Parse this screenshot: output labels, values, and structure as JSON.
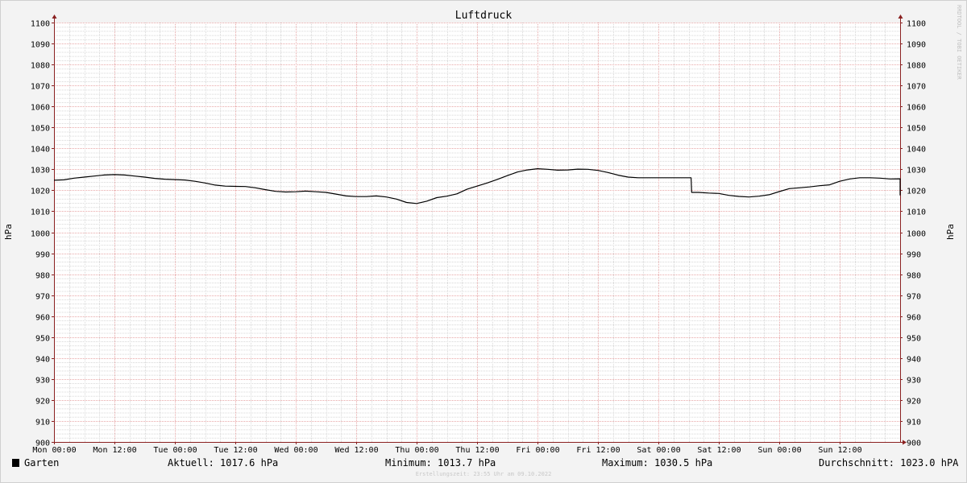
{
  "chart_data": {
    "type": "line",
    "title": "Luftdruck",
    "ylabel": "hPa",
    "ylabel_right": "hPa",
    "ylim": [
      900,
      1100
    ],
    "y_ticks": [
      900,
      910,
      920,
      930,
      940,
      950,
      960,
      970,
      980,
      990,
      1000,
      1010,
      1020,
      1030,
      1040,
      1050,
      1060,
      1070,
      1080,
      1090,
      1100
    ],
    "x_ticks": [
      "Mon 00:00",
      "Mon 12:00",
      "Tue 00:00",
      "Tue 12:00",
      "Wed 00:00",
      "Wed 12:00",
      "Thu 00:00",
      "Thu 12:00",
      "Fri 00:00",
      "Fri 12:00",
      "Sat 00:00",
      "Sat 12:00",
      "Sun 00:00",
      "Sun 12:00"
    ],
    "xlim_hours": [
      0,
      168
    ],
    "grid": true,
    "side_text": "RRDTOOL / TOBI OETIKER",
    "series": [
      {
        "name": "Garten",
        "color": "#000000",
        "points": [
          [
            0,
            1024.8
          ],
          [
            2,
            1025.0
          ],
          [
            4,
            1025.8
          ],
          [
            6,
            1026.3
          ],
          [
            8,
            1026.8
          ],
          [
            10,
            1027.3
          ],
          [
            12,
            1027.5
          ],
          [
            14,
            1027.3
          ],
          [
            16,
            1026.8
          ],
          [
            18,
            1026.3
          ],
          [
            20,
            1025.7
          ],
          [
            22,
            1025.3
          ],
          [
            24,
            1025.1
          ],
          [
            26,
            1024.9
          ],
          [
            28,
            1024.3
          ],
          [
            30,
            1023.5
          ],
          [
            32,
            1022.5
          ],
          [
            34,
            1022.0
          ],
          [
            36,
            1021.9
          ],
          [
            38,
            1021.8
          ],
          [
            40,
            1021.2
          ],
          [
            42,
            1020.3
          ],
          [
            44,
            1019.5
          ],
          [
            46,
            1019.2
          ],
          [
            48,
            1019.3
          ],
          [
            50,
            1019.6
          ],
          [
            52,
            1019.3
          ],
          [
            54,
            1019.0
          ],
          [
            56,
            1018.2
          ],
          [
            58,
            1017.3
          ],
          [
            60,
            1017.0
          ],
          [
            62,
            1017.0
          ],
          [
            64,
            1017.3
          ],
          [
            66,
            1016.8
          ],
          [
            68,
            1015.8
          ],
          [
            70,
            1014.2
          ],
          [
            72,
            1013.7
          ],
          [
            74,
            1014.8
          ],
          [
            76,
            1016.5
          ],
          [
            78,
            1017.2
          ],
          [
            80,
            1018.3
          ],
          [
            82,
            1020.5
          ],
          [
            84,
            1022.0
          ],
          [
            86,
            1023.5
          ],
          [
            88,
            1025.2
          ],
          [
            90,
            1027.0
          ],
          [
            92,
            1028.7
          ],
          [
            94,
            1029.7
          ],
          [
            96,
            1030.3
          ],
          [
            98,
            1030.0
          ],
          [
            100,
            1029.6
          ],
          [
            102,
            1029.7
          ],
          [
            104,
            1030.1
          ],
          [
            106,
            1030.0
          ],
          [
            108,
            1029.5
          ],
          [
            110,
            1028.5
          ],
          [
            112,
            1027.2
          ],
          [
            114,
            1026.3
          ],
          [
            116,
            1026.0
          ],
          [
            118,
            1026.0
          ],
          [
            120,
            1026.0
          ],
          [
            124,
            1026.0
          ],
          [
            126.5,
            1026.0
          ],
          [
            126.6,
            1019.0
          ],
          [
            128,
            1019.0
          ],
          [
            130,
            1018.7
          ],
          [
            132,
            1018.5
          ],
          [
            134,
            1017.6
          ],
          [
            136,
            1017.1
          ],
          [
            138,
            1016.8
          ],
          [
            140,
            1017.2
          ],
          [
            142,
            1017.9
          ],
          [
            144,
            1019.4
          ],
          [
            146,
            1020.8
          ],
          [
            148,
            1021.2
          ],
          [
            150,
            1021.6
          ],
          [
            152,
            1022.2
          ],
          [
            154,
            1022.6
          ],
          [
            156,
            1024.3
          ],
          [
            158,
            1025.4
          ],
          [
            160,
            1026.0
          ],
          [
            162,
            1026.0
          ],
          [
            164,
            1025.8
          ],
          [
            166,
            1025.4
          ],
          [
            168,
            1025.5
          ],
          [
            170,
            1025.3
          ],
          [
            172,
            1024.2
          ],
          [
            174,
            1022.5
          ],
          [
            176,
            1020.7
          ],
          [
            178,
            1019.3
          ],
          [
            180,
            1018.5
          ],
          [
            182,
            1018.4
          ],
          [
            184,
            1017.9
          ],
          [
            185.5,
            1017.6
          ]
        ]
      }
    ]
  },
  "legend": {
    "series_label": "Garten",
    "current": "Aktuell: 1017.6 hPa",
    "minimum": "Minimum: 1013.7 hPa",
    "maximum": "Maximum: 1030.5 hPa",
    "average": "Durchschnitt: 1023.0 hPA"
  },
  "footer": "Erstellungszeit: 23:55 Uhr am 09.10.2022"
}
